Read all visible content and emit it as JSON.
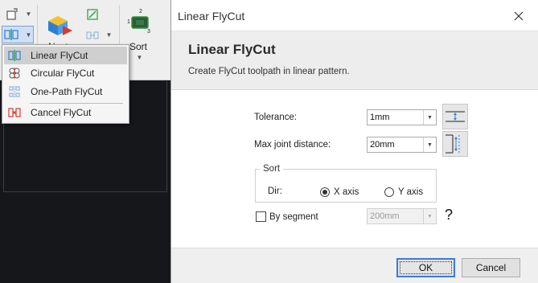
{
  "ribbon": {
    "nest_label": "Nest",
    "sort_label": "Sort",
    "sort_icon_numbers": [
      "1",
      "2",
      "3"
    ],
    "icons": [
      "select-icon",
      "flycut-icon",
      "nest-icon",
      "bridge-icon",
      "array-icon",
      "sort-icon"
    ]
  },
  "menu": {
    "items": [
      {
        "label": "Linear FlyCut",
        "icon": "linear-flycut-icon",
        "selected": true
      },
      {
        "label": "Circular FlyCut",
        "icon": "circular-flycut-icon",
        "selected": false
      },
      {
        "label": "One-Path FlyCut",
        "icon": "one-path-flycut-icon",
        "selected": false
      },
      {
        "label": "Cancel FlyCut",
        "icon": "cancel-flycut-icon",
        "selected": false
      }
    ]
  },
  "dialog": {
    "window_title": "Linear FlyCut",
    "heading": "Linear FlyCut",
    "description": "Create FlyCut toolpath in linear pattern.",
    "tolerance": {
      "label": "Tolerance:",
      "value": "1mm"
    },
    "max_joint": {
      "label": "Max joint distance:",
      "value": "20mm"
    },
    "sort": {
      "legend": "Sort",
      "dir_label": "Dir:",
      "x_axis_label": "X axis",
      "y_axis_label": "Y axis",
      "selected": "x"
    },
    "by_segment": {
      "label": "By segment",
      "checked": false,
      "value": "200mm",
      "help": "?"
    },
    "ok_label": "OK",
    "cancel_label": "Cancel"
  },
  "colors": {
    "accent": "#3b7bd6",
    "icon_blue": "#2e7fd2",
    "icon_red": "#d83a2e",
    "icon_green": "#2c9a3a",
    "dark_viewport": "#16181c"
  }
}
